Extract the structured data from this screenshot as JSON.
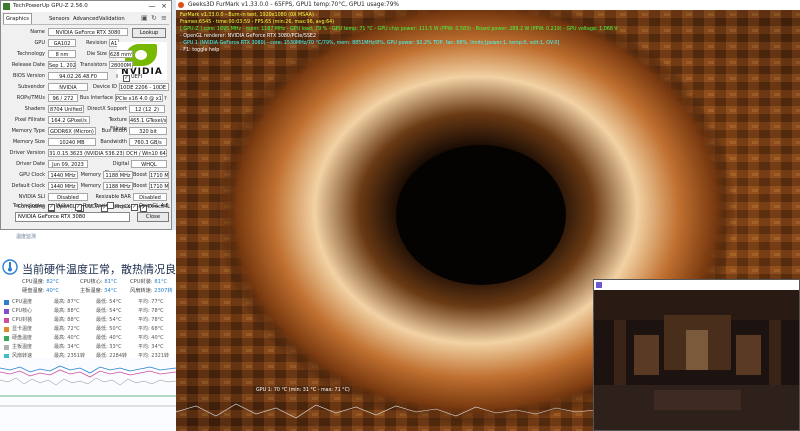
{
  "gpuz": {
    "title": "TechPowerUp GPU-Z 2.56.0",
    "tabs": [
      "Graphics Card",
      "Sensors",
      "Advanced",
      "Validation"
    ],
    "minimize": "—",
    "close": "×",
    "vendor_logo_text": "NVIDIA",
    "lookup_label": "Lookup",
    "uefi_label": "UEFI",
    "close_button": "Close",
    "gpu_select": "NVIDIA GeForce RTX 3080",
    "fields": {
      "name_label": "Name",
      "name": "NVIDIA GeForce RTX 3080",
      "gpu_label": "GPU",
      "gpu": "GA102",
      "revision_label": "Revision",
      "revision": "A1",
      "technology_label": "Technology",
      "technology": "8 nm",
      "die_size_label": "Die Size",
      "die_size": "628 mm²",
      "release_date_label": "Release Date",
      "release_date": "Sep 1, 2020",
      "transistors_label": "Transistors",
      "transistors": "28000M",
      "bios_label": "BIOS Version",
      "bios": "94.02.26.48.F0",
      "subvendor_label": "Subvendor",
      "subvendor": "NVIDIA",
      "device_id_label": "Device ID",
      "device_id": "10DE 2206 - 10DE 1455",
      "rops_label": "ROPs/TMUs",
      "rops": "96 / 272",
      "bus_label": "Bus Interface",
      "bus": "PCIe x16 4.0 @ x16 3.0",
      "shaders_label": "Shaders",
      "shaders": "8704 Unified",
      "directx_label": "DirectX Support",
      "directx": "12 (12_2)",
      "pixel_fill_label": "Pixel Fillrate",
      "pixel_fill": "164.2 GPixel/s",
      "texture_fill_label": "Texture Fillrate",
      "texture_fill": "465.1 GTexel/s",
      "mem_type_label": "Memory Type",
      "mem_type": "GDDR6X (Micron)",
      "bus_width_label": "Bus Width",
      "bus_width": "320 bit",
      "mem_size_label": "Memory Size",
      "mem_size": "10240 MB",
      "bandwidth_label": "Bandwidth",
      "bandwidth": "760.3 GB/s",
      "driver_ver_label": "Driver Version",
      "driver_ver": "31.0.15.3623 (NVIDIA 536.23) DCH / Win10 64",
      "driver_date_label": "Driver Date",
      "driver_date": "Jun 09, 2023",
      "dig_sig_label": "Digital Signature",
      "dig_sig": "WHQL",
      "gpu_clock_label": "GPU Clock",
      "gpu_clock": "1440 MHz",
      "memory_label": "Memory",
      "memory_clock": "1188 MHz",
      "boost_label": "Boost",
      "boost": "1710 MHz",
      "default_clock_label": "Default Clock",
      "default_clock": "1440 MHz",
      "default_memory": "1188 MHz",
      "default_boost": "1710 MHz",
      "sli_label": "NVIDIA SLI",
      "sli": "Disabled",
      "resizable_bar_label": "Resizable BAR",
      "resizable_bar": "Disabled"
    },
    "computing_label": "Computing",
    "computing": [
      "OpenCL",
      "CUDA",
      "DirectCompute",
      "DirectML"
    ],
    "technologies_label": "Technologies",
    "technologies": [
      "Vulkan",
      "Ray Tracing",
      "PhysX",
      "OpenGL 4.6"
    ]
  },
  "monitor": {
    "small_text": "温度监测",
    "headline": "当前硬件温度正常，散热情况良好",
    "stats": {
      "cpu_temp_label": "CPU温度:",
      "cpu_temp": "82°C",
      "cpu_core_label": "CPU核心:",
      "cpu_core": "81°C",
      "cpu_pkg_label": "CPU封装:",
      "cpu_pkg": "81°C",
      "disk_label": "硬盘温度:",
      "disk": "40°C",
      "board_label": "主板温度:",
      "board": "34°C",
      "fan_label": "风扇转速:",
      "fan": "2307转"
    },
    "legend": [
      {
        "name": "CPU温度",
        "v1": "最高: 87°C",
        "v2": "最低: 54°C",
        "v3": "平均: 77°C",
        "color": "#2a7fd0"
      },
      {
        "name": "CPU核心",
        "v1": "最高: 88°C",
        "v2": "最低: 54°C",
        "v3": "平均: 78°C",
        "color": "#7b4fd0"
      },
      {
        "name": "CPU封装",
        "v1": "最高: 88°C",
        "v2": "最低: 54°C",
        "v3": "平均: 78°C",
        "color": "#d04f9a"
      },
      {
        "name": "显卡温度",
        "v1": "最高: 72°C",
        "v2": "最低: 50°C",
        "v3": "平均: 68°C",
        "color": "#e08a2a"
      },
      {
        "name": "硬盘温度",
        "v1": "最高: 40°C",
        "v2": "最低: 40°C",
        "v3": "平均: 40°C",
        "color": "#3aa85a"
      },
      {
        "name": "主板温度",
        "v1": "最高: 34°C",
        "v2": "最低: 33°C",
        "v3": "平均: 34°C",
        "color": "#b0b0b0"
      },
      {
        "name": "风扇转速",
        "v1": "最高: 2351转",
        "v2": "最低: 2284转",
        "v3": "平均: 2321转",
        "color": "#40c0c0"
      }
    ]
  },
  "furmark": {
    "title": "Geeks3D FurMark v1.33.0.0 - 65FPS, GPU1 temp:70°C, GPU1 usage:79%",
    "osd": [
      {
        "text": "FurMark v1.33.0.0 - Burn-in test, 1920x1080 (0X MSAA)",
        "color": "#ffff40"
      },
      {
        "text": "Frames:6545 - time:00:03:59 - FPS:65 (min:26, max:96, avg:64)",
        "color": "#ffff40"
      },
      {
        "text": "[ GPU-Z ] core: 1695 MHz - mem: 1187 MHz - GPU load: 79 % - GPU temp: 71 °C - GPU chip power: 111.5 W (PPW: 0.583) - Board power: 288.2 W (PPW: 0.219) - GPU voltage: 1.068 V",
        "color": "#40ff40"
      },
      {
        "text": "- OpenGL renderer: NVIDIA GeForce RTX 3080/PCIe/SSE2",
        "color": "#ffffff"
      },
      {
        "text": "- GPU 1 (NVIDIA GeForce RTX 3080) - core: 1530MHz/70 °C/79%, mem: 8851MHz/8%, GPU power: 92.2% TDP, fan: 68%, limits:[power:1, temp:0, volt:1, OV:0]",
        "color": "#40ffff"
      },
      {
        "text": "- F1: toggle help",
        "color": "#ffffff"
      }
    ],
    "graph_label": "GPU 1: 70 °C (min: 31 °C - max: 71 °C)"
  }
}
